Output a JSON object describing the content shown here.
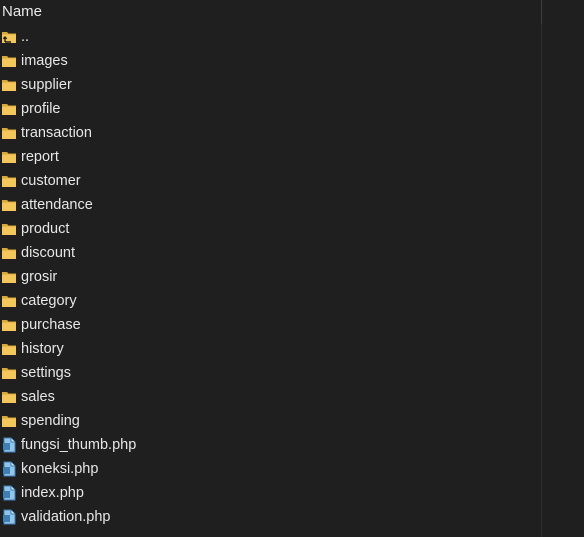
{
  "header": {
    "name_label": "Name"
  },
  "items": [
    {
      "label": "..",
      "type": "up",
      "icon": "parent-folder-icon"
    },
    {
      "label": "images",
      "type": "folder",
      "icon": "folder-icon"
    },
    {
      "label": "supplier",
      "type": "folder",
      "icon": "folder-icon"
    },
    {
      "label": "profile",
      "type": "folder",
      "icon": "folder-icon"
    },
    {
      "label": "transaction",
      "type": "folder",
      "icon": "folder-icon"
    },
    {
      "label": "report",
      "type": "folder",
      "icon": "folder-icon"
    },
    {
      "label": "customer",
      "type": "folder",
      "icon": "folder-icon"
    },
    {
      "label": "attendance",
      "type": "folder",
      "icon": "folder-icon"
    },
    {
      "label": "product",
      "type": "folder",
      "icon": "folder-icon"
    },
    {
      "label": "discount",
      "type": "folder",
      "icon": "folder-icon"
    },
    {
      "label": "grosir",
      "type": "folder",
      "icon": "folder-icon"
    },
    {
      "label": "category",
      "type": "folder",
      "icon": "folder-icon"
    },
    {
      "label": "purchase",
      "type": "folder",
      "icon": "folder-icon"
    },
    {
      "label": "history",
      "type": "folder",
      "icon": "folder-icon"
    },
    {
      "label": "settings",
      "type": "folder",
      "icon": "folder-icon"
    },
    {
      "label": "sales",
      "type": "folder",
      "icon": "folder-icon"
    },
    {
      "label": "spending",
      "type": "folder",
      "icon": "folder-icon"
    },
    {
      "label": "fungsi_thumb.php",
      "type": "file",
      "icon": "php-file-icon"
    },
    {
      "label": "koneksi.php",
      "type": "file",
      "icon": "php-file-icon"
    },
    {
      "label": "index.php",
      "type": "file",
      "icon": "php-file-icon"
    },
    {
      "label": "validation.php",
      "type": "file",
      "icon": "php-file-icon"
    }
  ],
  "colors": {
    "background": "#1f1f1f",
    "text": "#e6e6e6",
    "folder": "#f3c75a",
    "folder_dark": "#d9a83a",
    "file": "#8fc6ec",
    "file_dark": "#3f7fb5"
  }
}
